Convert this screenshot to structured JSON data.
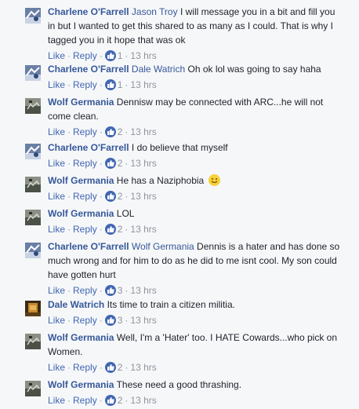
{
  "action_labels": {
    "like": "Like",
    "reply": "Reply",
    "dot": "·"
  },
  "colors": {
    "link": "#365899",
    "action": "#4267b2",
    "meta": "#90949c",
    "like_badge": "#4267b2"
  },
  "comments": [
    {
      "author": "Charlene O'Farrell",
      "avatar": "charlene-avatar",
      "mention": "Jason Troy",
      "text": " I will message you in a bit and fill you in but I wanted to get this shared to as many as I could. That is why I tagged you in it hope that was ok",
      "likes": "1",
      "time": "13 hrs"
    },
    {
      "author": "Charlene O'Farrell",
      "avatar": "charlene-avatar",
      "mention": "Dale Watrich",
      "text": " Oh ok lol was going to say haha",
      "likes": "1",
      "time": "13 hrs"
    },
    {
      "author": "Wolf Germania",
      "avatar": "wolf-avatar",
      "mention": "",
      "text": " Dennisw may be connected with ARC...he will not come clean.",
      "likes": "2",
      "time": "13 hrs"
    },
    {
      "author": "Charlene O'Farrell",
      "avatar": "charlene-avatar",
      "mention": "",
      "text": " I do believe that myself",
      "likes": "2",
      "time": "13 hrs"
    },
    {
      "author": "Wolf Germania",
      "avatar": "wolf-avatar",
      "mention": "",
      "text": " He has a Naziphobia",
      "emoji": "smiley-emoji-icon",
      "likes": "2",
      "time": "13 hrs"
    },
    {
      "author": "Wolf Germania",
      "avatar": "wolf-avatar",
      "mention": "",
      "text": " LOL",
      "likes": "2",
      "time": "13 hrs"
    },
    {
      "author": "Charlene O'Farrell",
      "avatar": "charlene-avatar",
      "mention": "Wolf Germania",
      "text": " Dennis is a hater and has done so much wrong and for him to do as he did to me isnt cool. My son could have gotten hurt",
      "likes": "3",
      "time": "13 hrs"
    },
    {
      "author": "Dale Watrich",
      "avatar": "dale-avatar",
      "mention": "",
      "text": " Its time to train a citizen militia.",
      "likes": "3",
      "time": "13 hrs"
    },
    {
      "author": "Wolf Germania",
      "avatar": "wolf-avatar",
      "mention": "",
      "text": " Well, I'm a 'Hater' too. I HATE Cowards...who pick on Women.",
      "likes": "2",
      "time": "13 hrs"
    },
    {
      "author": "Wolf Germania",
      "avatar": "wolf-avatar",
      "mention": "",
      "text": " These need a good thrashing.",
      "likes": "2",
      "time": "13 hrs"
    }
  ]
}
